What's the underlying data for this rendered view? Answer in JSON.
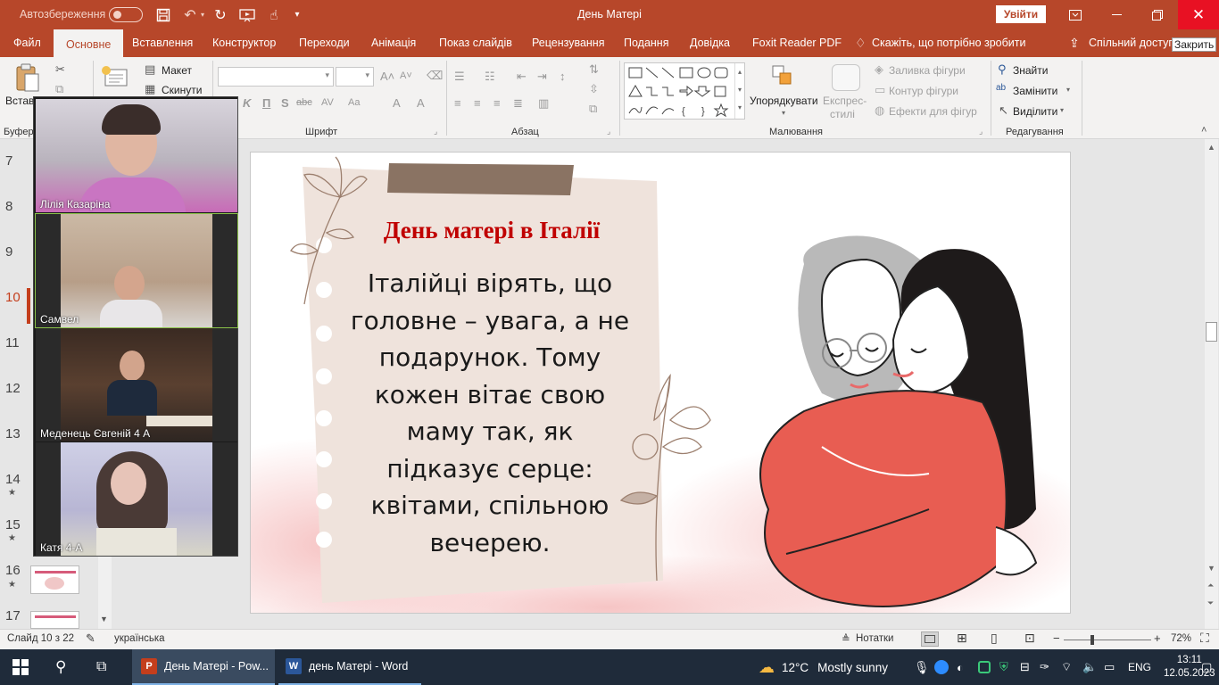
{
  "titlebar": {
    "autosave_label": "Автозбереження",
    "doc_title": "День Матері",
    "signin_label": "Увійти"
  },
  "ribbon_tabs": [
    "Файл",
    "Основне",
    "Вставлення",
    "Конструктор",
    "Переходи",
    "Анімація",
    "Показ слайдів",
    "Рецензування",
    "Подання",
    "Довідка",
    "Foxit Reader PDF"
  ],
  "tell_me": "Скажіть, що потрібно зробити",
  "share_label": "Спільний доступ",
  "close_tooltip": "Закрить",
  "ribbon": {
    "paste_label": "Встав",
    "clipboard_label": "Буфер",
    "layout_label": "Макет",
    "reset_label": "Скинути",
    "font_group": "Шрифт",
    "paragraph_group": "Абзац",
    "arrange_label": "Упорядкувати",
    "quick_styles_line1": "Експрес-",
    "quick_styles_line2": "стилі",
    "shape_fill": "Заливка фігури",
    "shape_outline": "Контур фігури",
    "shape_effects": "Ефекти для фігур",
    "drawing_group": "Малювання",
    "find_label": "Знайти",
    "replace_label": "Замінити",
    "select_label": "Виділити",
    "editing_group": "Редагування"
  },
  "thumbnails": {
    "numbers": [
      "7",
      "8",
      "9",
      "10",
      "11",
      "12",
      "13",
      "14",
      "15",
      "16",
      "17"
    ],
    "active": "10"
  },
  "zoom_participants": [
    "Лілія Казаріна",
    "Самвел",
    "Меденець Євгеній 4 А",
    "Катя  4-А"
  ],
  "slide": {
    "title": "День матері в Італії",
    "body": "Італійці вірять, що головне – увага, а не подарунок. Тому кожен вітає свою маму так, як підказує серце: квітами, спільною вечерею."
  },
  "statusbar": {
    "slide_counter": "Слайд 10 з 22",
    "language": "українська",
    "notes_label": "Нотатки",
    "zoom_level": "72%"
  },
  "taskbar": {
    "apps": [
      "День Матері - Pow...",
      "день Матері - Word"
    ],
    "weather_temp": "12°C",
    "weather_text": "Mostly sunny",
    "lang": "ENG",
    "time": "13:11",
    "date": "12.05.2023"
  },
  "colors": {
    "accent": "#b7472a",
    "title_red": "#c00000",
    "figure_red": "#e85d52"
  }
}
